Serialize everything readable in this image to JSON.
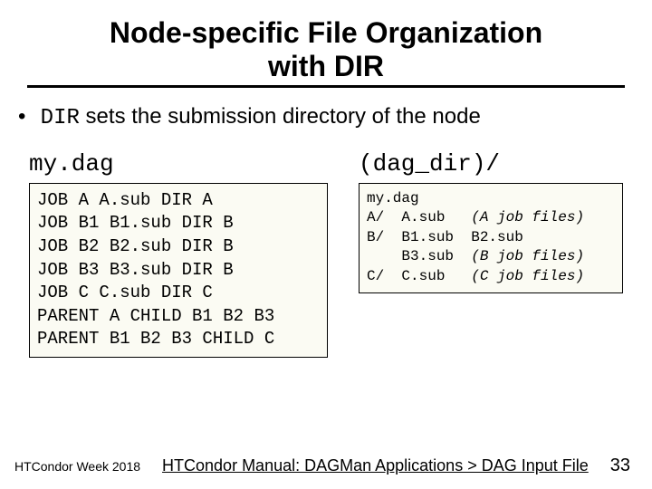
{
  "title": {
    "line1": "Node-specific File Organization",
    "line2": "with DIR"
  },
  "bullet": {
    "marker": "•",
    "pre": "DIR",
    "post": " sets the submission directory of the node"
  },
  "left": {
    "header": "my.dag",
    "code": "JOB A A.sub DIR A\nJOB B1 B1.sub DIR B\nJOB B2 B2.sub DIR B\nJOB B3 B3.sub DIR B\nJOB C C.sub DIR C\nPARENT A CHILD B1 B2 B3\nPARENT B1 B2 B3 CHILD C"
  },
  "right": {
    "header": "(dag_dir)/",
    "lines": [
      {
        "t": "my.dag",
        "i": ""
      },
      {
        "t": "A/  A.sub   ",
        "i": "(A job files)"
      },
      {
        "t": "B/  B1.sub  B2.sub",
        "i": ""
      },
      {
        "t": "    B3.sub  ",
        "i": "(B job files)"
      },
      {
        "t": "C/  C.sub   ",
        "i": "(C job files)"
      }
    ]
  },
  "footer": {
    "left": "HTCondor Week 2018",
    "center": "HTCondor Manual: DAGMan Applications > DAG Input File",
    "right": "33"
  }
}
